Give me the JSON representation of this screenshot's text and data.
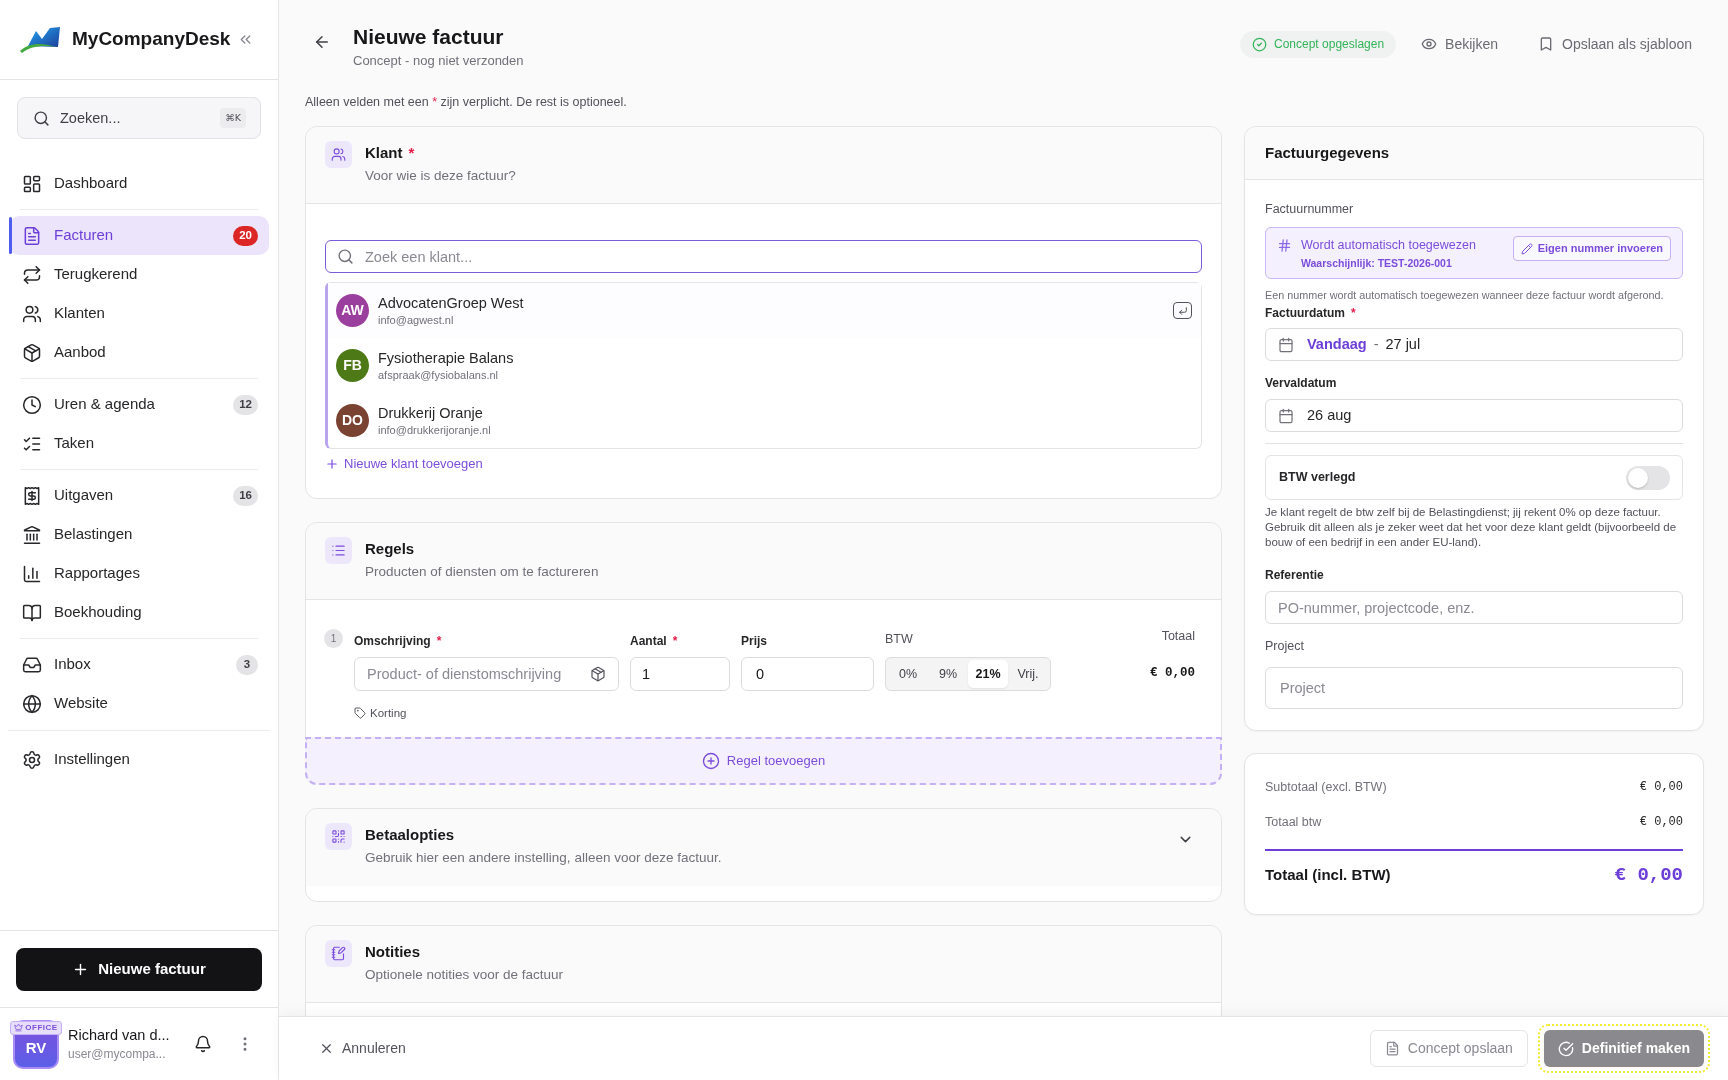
{
  "sidebar": {
    "brand": "MyCompanyDesk",
    "search": {
      "placeholder": "Zoeken...",
      "shortcut": "⌘K"
    },
    "nav_groups": [
      {
        "items": [
          {
            "label": "Dashboard",
            "selected": false
          }
        ]
      },
      {
        "items": [
          {
            "label": "Facturen",
            "selected": true,
            "badge": {
              "text": "20",
              "color": "#dc2626"
            }
          },
          {
            "label": "Terugkerend",
            "selected": false
          },
          {
            "label": "Klanten",
            "selected": false
          },
          {
            "label": "Aanbod",
            "selected": false
          }
        ]
      },
      {
        "items": [
          {
            "label": "Uren & agenda",
            "selected": false,
            "badge": {
              "text": "12",
              "color": "#e4e4e7"
            }
          },
          {
            "label": "Taken",
            "selected": false
          }
        ]
      },
      {
        "items": [
          {
            "label": "Uitgaven",
            "selected": false,
            "badge": {
              "text": "16",
              "color": "#e4e4e7"
            }
          },
          {
            "label": "Belastingen",
            "selected": false
          },
          {
            "label": "Rapportages",
            "selected": false
          },
          {
            "label": "Boekhouding",
            "selected": false
          }
        ]
      },
      {
        "items": [
          {
            "label": "Inbox",
            "selected": false,
            "badge": {
              "text": "3",
              "color": "#e4e4e7"
            }
          },
          {
            "label": "Website",
            "selected": false
          }
        ]
      },
      {
        "items": [
          {
            "label": "Instellingen",
            "selected": false
          }
        ]
      }
    ],
    "new_invoice_button": "Nieuwe factuur",
    "user": {
      "plan": "OFFICE",
      "initials": "RV",
      "name": "Richard van d...",
      "email": "user@mycompa..."
    }
  },
  "header": {
    "title": "Nieuwe factuur",
    "subtitle": "Concept - nog niet verzonden",
    "save_status": "Concept opgeslagen",
    "actions": [
      "Bekijken",
      "Opslaan als sjabloon"
    ]
  },
  "required_note": {
    "before": "Alleen velden met een",
    "mark": "*",
    "after": "zijn verplicht. De rest is optioneel."
  },
  "client_section": {
    "title": "Klant",
    "required_mark": "*",
    "subtitle": "Voor wie is deze factuur?",
    "search": {
      "placeholder": "Zoek een klant..."
    },
    "clients": [
      {
        "initials": "AW",
        "name": "AdvocatenGroep West",
        "email": "info@agwest.nl",
        "color": "#9b3f9e",
        "selected": true
      },
      {
        "initials": "FB",
        "name": "Fysiotherapie Balans",
        "email": "afspraak@fysiobalans.nl",
        "color": "#4d7a16",
        "selected": false
      },
      {
        "initials": "DO",
        "name": "Drukkerij Oranje",
        "email": "info@drukkerijoranje.nl",
        "color": "#7a4230",
        "selected": false
      }
    ],
    "add_link": "Nieuwe klant toevoegen"
  },
  "lines_section": {
    "title": "Regels",
    "subtitle": "Producten of diensten om te factureren",
    "lines": [
      {
        "number": "1",
        "description": {
          "label": "Omschrijving",
          "required_mark": "*",
          "placeholder": "Product- of dienstomschrijving"
        },
        "quantity": {
          "label": "Aantal",
          "required_mark": "*",
          "value": "1"
        },
        "price": {
          "label": "Prijs",
          "value": "0"
        },
        "vat": {
          "label": "BTW",
          "options": [
            {
              "label": "0%",
              "selected": false
            },
            {
              "label": "9%",
              "selected": false
            },
            {
              "label": "21%",
              "selected": true
            },
            {
              "label": "Vrij.",
              "selected": false
            }
          ]
        },
        "total": {
          "label": "Totaal",
          "value": "€ 0,00"
        },
        "discount_link": "Korting"
      }
    ],
    "add_button": "Regel toevoegen"
  },
  "payment_section": {
    "title": "Betaalopties",
    "subtitle": "Gebruik hier een andere instelling, alleen voor deze factuur.",
    "expanded": false
  },
  "notes_section": {
    "title": "Notities",
    "subtitle": "Optionele notities voor de factuur"
  },
  "invoice_details": {
    "title": "Factuurgegevens",
    "number": {
      "label": "Factuurnummer",
      "auto_text": "Wordt automatisch toegewezen",
      "likely": "Waarschijnlijk: TEST-2026-001",
      "custom_button": "Eigen nummer invoeren",
      "hint": "Een nummer wordt automatisch toegewezen wanneer deze factuur wordt afgerond."
    },
    "invoice_date": {
      "label": "Factuurdatum",
      "required_mark": "*",
      "relative": "Vandaag",
      "separator": "-",
      "value": "27 jul"
    },
    "due_date": {
      "label": "Vervaldatum",
      "value": "26 aug"
    },
    "reverse_charge": {
      "label": "BTW verlegd",
      "on": false,
      "description": "Je klant regelt de btw zelf bij de Belastingdienst; jij rekent 0% op deze factuur. Gebruik dit alleen als je zeker weet dat het voor deze klant geldt (bijvoorbeeld de bouw of een bedrijf in een ander EU-land)."
    },
    "reference": {
      "label": "Referentie",
      "placeholder": "PO-nummer, projectcode, enz."
    },
    "project": {
      "label": "Project",
      "placeholder": "Project"
    }
  },
  "totals": {
    "rows": [
      {
        "label": "Subtotaal (excl. BTW)",
        "value": "€ 0,00"
      },
      {
        "label": "Totaal btw",
        "value": "€ 0,00"
      }
    ],
    "grand_total": {
      "label": "Totaal (incl. BTW)",
      "value": "€ 0,00"
    }
  },
  "footer": {
    "cancel": "Annuleren",
    "save_draft": {
      "label": "Concept opslaan",
      "disabled": true
    },
    "finalize": {
      "label": "Definitief maken",
      "disabled": true,
      "highlighted": true
    }
  }
}
